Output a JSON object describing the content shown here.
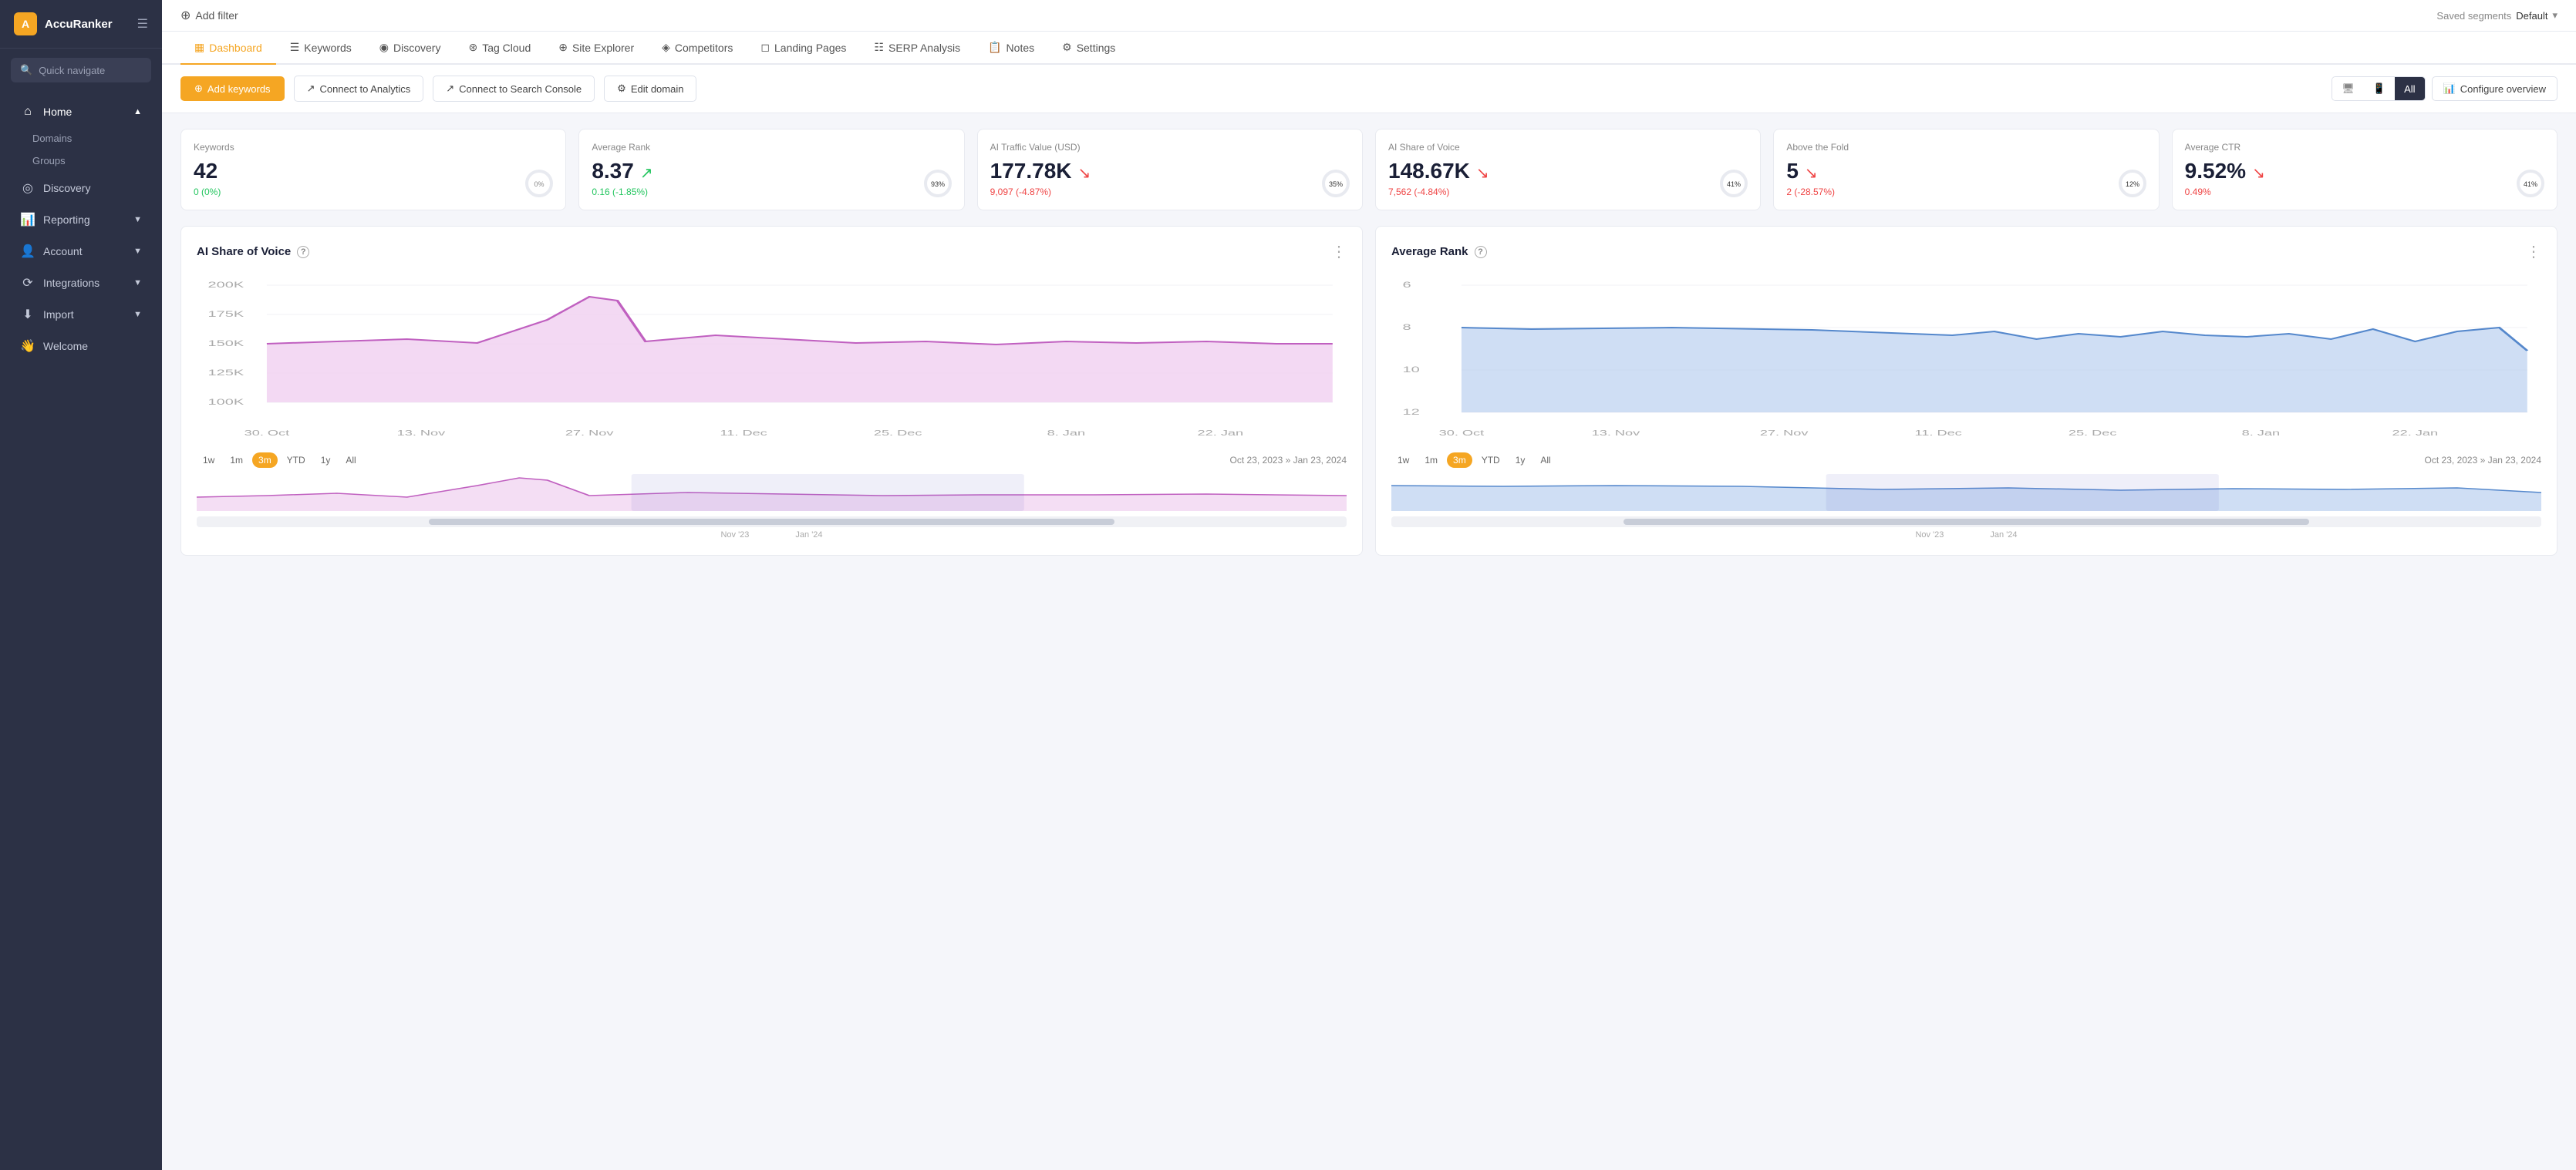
{
  "sidebar": {
    "logo": "AccuRanker",
    "quick_navigate": "Quick navigate",
    "nav_items": [
      {
        "id": "home",
        "label": "Home",
        "icon": "⌂",
        "expanded": true,
        "sub_items": [
          "Domains",
          "Groups"
        ]
      },
      {
        "id": "discovery",
        "label": "Discovery",
        "icon": "◎"
      },
      {
        "id": "reporting",
        "label": "Reporting",
        "icon": "📊",
        "expanded": false
      },
      {
        "id": "account",
        "label": "Account",
        "icon": "👤",
        "expanded": false
      },
      {
        "id": "integrations",
        "label": "Integrations",
        "icon": "🔗",
        "expanded": false
      },
      {
        "id": "import",
        "label": "Import",
        "icon": "⬇",
        "expanded": false
      },
      {
        "id": "welcome",
        "label": "Welcome",
        "icon": "👋"
      }
    ]
  },
  "topbar": {
    "add_filter": "Add filter",
    "saved_segments": "Saved segments",
    "default_segment": "Default"
  },
  "tabs": [
    {
      "id": "dashboard",
      "label": "Dashboard",
      "active": true
    },
    {
      "id": "keywords",
      "label": "Keywords"
    },
    {
      "id": "discovery",
      "label": "Discovery"
    },
    {
      "id": "tag_cloud",
      "label": "Tag Cloud"
    },
    {
      "id": "site_explorer",
      "label": "Site Explorer"
    },
    {
      "id": "competitors",
      "label": "Competitors"
    },
    {
      "id": "landing_pages",
      "label": "Landing Pages"
    },
    {
      "id": "serp_analysis",
      "label": "SERP Analysis"
    },
    {
      "id": "notes",
      "label": "Notes"
    },
    {
      "id": "settings",
      "label": "Settings"
    }
  ],
  "actions": {
    "add_keywords": "Add keywords",
    "connect_analytics": "Connect to Analytics",
    "connect_search_console": "Connect to Search Console",
    "edit_domain": "Edit domain",
    "configure_overview": "Configure overview",
    "view_all": "All"
  },
  "kpi_cards": [
    {
      "label": "Keywords",
      "value": "42",
      "change": "0 (0%)",
      "change_type": "neutral",
      "percent": 0,
      "trend": "none"
    },
    {
      "label": "Average Rank",
      "value": "8.37",
      "change": "0.16 (-1.85%)",
      "change_type": "positive",
      "percent": 93,
      "trend": "up"
    },
    {
      "label": "AI Traffic Value (USD)",
      "value": "177.78K",
      "change": "9,097 (-4.87%)",
      "change_type": "negative",
      "percent": 35,
      "trend": "down"
    },
    {
      "label": "AI Share of Voice",
      "value": "148.67K",
      "change": "7,562 (-4.84%)",
      "change_type": "negative",
      "percent": 41,
      "trend": "down"
    },
    {
      "label": "Above the Fold",
      "value": "5",
      "change": "2 (-28.57%)",
      "change_type": "negative",
      "percent": 12,
      "trend": "down"
    },
    {
      "label": "Average CTR",
      "value": "9.52%",
      "change": "0.49%",
      "change_type": "negative",
      "percent": 41,
      "trend": "down"
    }
  ],
  "charts": {
    "share_of_voice": {
      "title": "AI Share of Voice",
      "time_range": "Oct 23, 2023 » Jan 23, 2024",
      "active_period": "3m",
      "periods": [
        "1w",
        "1m",
        "3m",
        "YTD",
        "1y",
        "All"
      ],
      "x_labels": [
        "30. Oct",
        "13. Nov",
        "27. Nov",
        "11. Dec",
        "25. Dec",
        "8. Jan",
        "22. Jan"
      ],
      "y_labels": [
        "200K",
        "175K",
        "150K",
        "125K",
        "100K"
      ],
      "color": "#d084d0"
    },
    "average_rank": {
      "title": "Average Rank",
      "time_range": "Oct 23, 2023 » Jan 23, 2024",
      "active_period": "3m",
      "periods": [
        "1w",
        "1m",
        "3m",
        "YTD",
        "1y",
        "All"
      ],
      "x_labels": [
        "30. Oct",
        "13. Nov",
        "27. Nov",
        "11. Dec",
        "25. Dec",
        "8. Jan",
        "22. Jan"
      ],
      "y_labels": [
        "6",
        "8",
        "10",
        "12"
      ],
      "color": "#6b9bd4"
    }
  }
}
